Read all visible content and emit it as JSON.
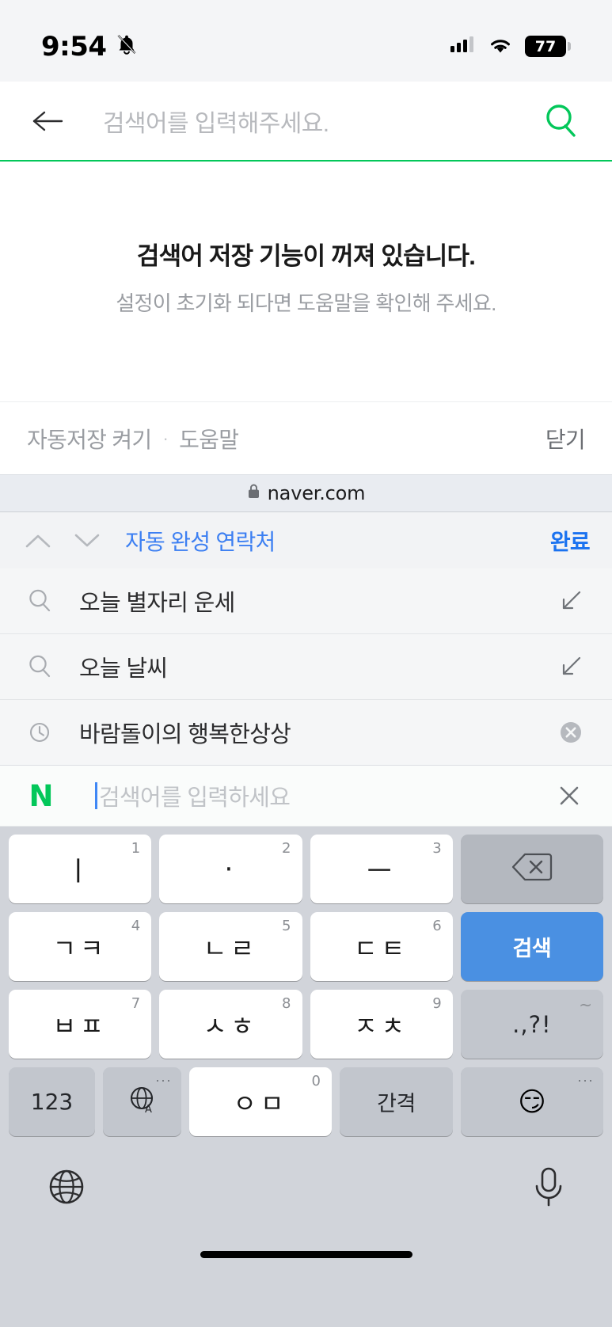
{
  "status_bar": {
    "time": "9:54",
    "mute_icon": "bell-slash-icon",
    "signal_icon": "cellular-signal-icon",
    "wifi_icon": "wifi-icon",
    "battery_level": "77"
  },
  "search_header": {
    "back_icon": "back-arrow-icon",
    "placeholder": "검색어를 입력해주세요.",
    "search_icon": "search-icon",
    "accent_color": "#03c75a"
  },
  "empty_state": {
    "title": "검색어 저장 기능이 꺼져 있습니다.",
    "subtitle": "설정이 초기화 되다면 도움말을 확인해 주세요."
  },
  "footer_bar": {
    "autosave_label": "자동저장 켜기",
    "separator": "·",
    "help_label": "도움말",
    "close_label": "닫기"
  },
  "domain_bar": {
    "lock_icon": "lock-icon",
    "domain": "naver.com"
  },
  "autofill_bar": {
    "prev_icon": "chevron-up-icon",
    "next_icon": "chevron-down-icon",
    "label": "자동 완성 연락처",
    "done_label": "완료",
    "link_color": "#3c7ff2"
  },
  "suggestions": [
    {
      "icon": "search-icon",
      "text": "오늘 별자리 운세",
      "action_icon": "arrow-down-left-icon"
    },
    {
      "icon": "search-icon",
      "text": "오늘 날씨",
      "action_icon": "arrow-down-left-icon"
    },
    {
      "icon": "clock-icon",
      "text": "바람돌이의 행복한상상",
      "action_icon": "remove-circle-icon"
    }
  ],
  "naver_input": {
    "logo": "N",
    "placeholder": "검색어를 입력하세요",
    "clear_icon": "close-icon"
  },
  "keyboard": {
    "rows": [
      [
        {
          "main": "ㅣ",
          "sup": "1",
          "type": "char"
        },
        {
          "main": "·",
          "sup": "2",
          "type": "char"
        },
        {
          "main": "ㅡ",
          "sup": "3",
          "type": "char"
        },
        {
          "main": "",
          "sup": "",
          "type": "backspace",
          "icon": "backspace-icon"
        }
      ],
      [
        {
          "main": "ㄱㅋ",
          "sup": "4",
          "type": "char"
        },
        {
          "main": "ㄴㄹ",
          "sup": "5",
          "type": "char"
        },
        {
          "main": "ㄷㅌ",
          "sup": "6",
          "type": "char"
        },
        {
          "main": "검색",
          "sup": "",
          "type": "search"
        }
      ],
      [
        {
          "main": "ㅂㅍ",
          "sup": "7",
          "type": "char"
        },
        {
          "main": "ㅅㅎ",
          "sup": "8",
          "type": "char"
        },
        {
          "main": "ㅈㅊ",
          "sup": "9",
          "type": "char"
        },
        {
          "main": ".,?!",
          "sup": "~",
          "type": "punct"
        }
      ]
    ],
    "bottom_row": {
      "numbers_label": "123",
      "globe_key_icon": "globe-language-icon",
      "center_main": "ㅇㅁ",
      "center_sup": "0",
      "space_label": "간격",
      "emoji": "😏"
    },
    "footer": {
      "globe_icon": "globe-icon",
      "mic_icon": "microphone-icon"
    }
  }
}
